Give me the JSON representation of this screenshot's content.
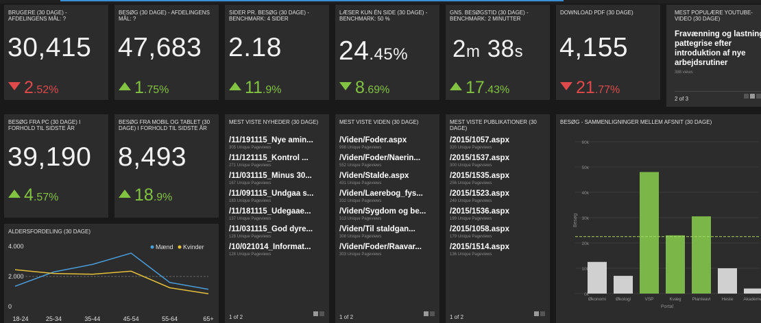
{
  "colors": {
    "background": "#191919",
    "tile": "#2c2c2c",
    "up": "#82c341",
    "down": "#e04a4a",
    "link": "#3b8fd6",
    "maend": "#4a9fdc",
    "kvinder": "#e6c13a",
    "bar_green": "#7ab648",
    "bar_gray": "#d0d0d0",
    "target_line": "#a8d95e"
  },
  "kpis": [
    {
      "label": "BRUGERE (30 dage) - Afdelingens mål: ?",
      "value": "30,415",
      "delta_main": "2",
      "delta_small": ".52%",
      "direction": "down",
      "icon": "triangle-down-icon"
    },
    {
      "label": "BESØG (30 dage) - Afdelingens mål: ?",
      "value": "47,683",
      "delta_main": "1",
      "delta_small": ".75%",
      "direction": "up",
      "icon": "triangle-up-icon"
    },
    {
      "label": "SIDER PR. BESØG (30 dage) - Benchmark: 4 sider",
      "value": "2.18",
      "delta_main": "11",
      "delta_small": ".9%",
      "direction": "up",
      "icon": "triangle-up-icon"
    },
    {
      "label": "LÆSER KUN ÉN SIDE (30 dage) - Benchmark: 50 %",
      "value_main": "24",
      "value_small": ".45%",
      "delta_main": "8",
      "delta_small": ".69%",
      "direction": "down",
      "icon": "triangle-down-icon"
    },
    {
      "label": "GNS. BESØGSTID (30 dage) - Benchmark: 2 minutter",
      "v1": "2",
      "u1": "m",
      "v2": "38",
      "u2": "s",
      "delta_main": "17",
      "delta_small": ".43%",
      "direction": "up",
      "icon": "triangle-up-icon"
    },
    {
      "label": "DOWNLOAD PDF (30 dage)",
      "value": "4,155",
      "delta_main": "21",
      "delta_small": ".77%",
      "direction": "down",
      "icon": "triangle-down-icon"
    }
  ],
  "youtube": {
    "label": "MEST POPULÆRE YOUTUBE-VIDEO (30 dage)",
    "title": "Fravænning og lastning af pattegrise efter introduktion af nye arbejdsrutiner",
    "views": "388 views",
    "pager": "2 of 3"
  },
  "kpis2": [
    {
      "label": "BESØG FRA PC (30 dage) I FORHOLD TIL SIDSTE ÅR",
      "value": "39,190",
      "delta_main": "4",
      "delta_small": ".57%",
      "direction": "up"
    },
    {
      "label": "BESØG FRA MOBIL OG TABLET (30 dage) I FORHOLD TIL SIDSTE ÅR",
      "value": "8,493",
      "delta_main": "18",
      "delta_small": ".9%",
      "direction": "up"
    }
  ],
  "lists": [
    {
      "label": "MEST VISTE NYHEDER (30 dage)",
      "pager": "1 of 2",
      "items": [
        {
          "title": "/11/191115_Nye amin...",
          "sub": "305 Unique Pageviews"
        },
        {
          "title": "/11/121115_Kontrol ...",
          "sub": "271 Unique Pageviews"
        },
        {
          "title": "/11/031115_Minus 30...",
          "sub": "167 Unique Pageviews"
        },
        {
          "title": "/11/091115_Undgaa s...",
          "sub": "183 Unique Pageviews"
        },
        {
          "title": "/11/181115_Udegaae...",
          "sub": "137 Unique Pageviews"
        },
        {
          "title": "/11/031115_God dyre...",
          "sub": "128 Unique Pageviews"
        },
        {
          "title": "/10/021014_Informat...",
          "sub": "128 Unique Pageviews"
        }
      ]
    },
    {
      "label": "MEST VISTE VIDEN (30 dage)",
      "pager": "1 of 2",
      "items": [
        {
          "title": "/Viden/Foder.aspx",
          "sub": "998 Unique Pageviews"
        },
        {
          "title": "/Viden/Foder/Naerin...",
          "sub": "552 Unique Pageviews"
        },
        {
          "title": "/Viden/Stalde.aspx",
          "sub": "431 Unique Pageviews"
        },
        {
          "title": "/Viden/Laerebog_fys...",
          "sub": "332 Unique Pageviews"
        },
        {
          "title": "/Viden/Sygdom og be...",
          "sub": "313 Unique Pageviews"
        },
        {
          "title": "/Viden/Til staldgan...",
          "sub": "308 Unique Pageviews"
        },
        {
          "title": "/Viden/Foder/Raavar...",
          "sub": "303 Unique Pageviews"
        }
      ]
    },
    {
      "label": "MEST VISTE PUBLIKATIONER (30 dage)",
      "pager": "1 of 2",
      "items": [
        {
          "title": "/2015/1057.aspx",
          "sub": "320 Unique Pageviews"
        },
        {
          "title": "/2015/1537.aspx",
          "sub": "300 Unique Pageviews"
        },
        {
          "title": "/2015/1535.aspx",
          "sub": "256 Unique Pageviews"
        },
        {
          "title": "/2015/1523.aspx",
          "sub": "249 Unique Pageviews"
        },
        {
          "title": "/2015/1536.aspx",
          "sub": "199 Unique Pageviews"
        },
        {
          "title": "/2015/1058.aspx",
          "sub": "179 Unique Pageviews"
        },
        {
          "title": "/2015/1514.aspx",
          "sub": "136 Unique Pageviews"
        }
      ]
    }
  ],
  "chart_data": [
    {
      "type": "line",
      "title": "ALDERSFORDELING (30 dage)",
      "categories": [
        "18-24",
        "25-34",
        "35-44",
        "45-54",
        "55-64",
        "65+"
      ],
      "series": [
        {
          "name": "Mænd",
          "color": "#4a9fdc",
          "values": [
            1350,
            2300,
            2800,
            3550,
            1600,
            1150
          ]
        },
        {
          "name": "Kvinder",
          "color": "#e6c13a",
          "values": [
            2450,
            2200,
            2150,
            2350,
            1250,
            850
          ]
        }
      ],
      "ylim": [
        0,
        4000
      ],
      "yticks": [
        "4.000",
        "2.000",
        "0"
      ],
      "legend": "top-right"
    },
    {
      "type": "bar",
      "title": "BESØG - SAMMENLIGNINGER MELLEM AFSNIT (30 dage)",
      "categories": [
        "Økonomi",
        "Økologi",
        "VSP",
        "Kvæg",
        "Planteavl",
        "Heste",
        "Akademet"
      ],
      "values": [
        12500,
        7000,
        48000,
        23000,
        30500,
        10000,
        2000
      ],
      "highlight": [
        false,
        false,
        true,
        true,
        true,
        false,
        false
      ],
      "target": 22500,
      "ylim": [
        0,
        60000
      ],
      "yticks": [
        "0k",
        "10k",
        "20k",
        "30k",
        "40k",
        "50k",
        "60k"
      ],
      "xlabel": "Portal",
      "ylabel": "Besøg",
      "grid": true
    }
  ]
}
